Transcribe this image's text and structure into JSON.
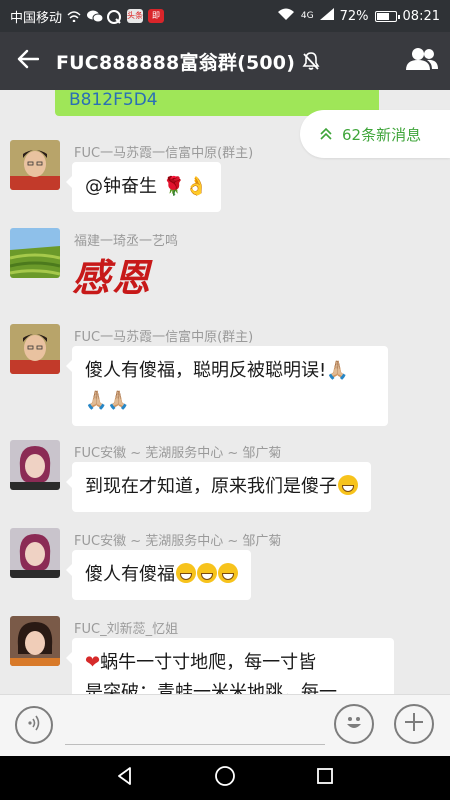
{
  "status": {
    "carrier": "中国移动",
    "network": "4G",
    "battery": "72%",
    "battery_level": 0.72,
    "time": "08:21",
    "app_badges": [
      "头条",
      "即"
    ]
  },
  "header": {
    "title": "FUC888888富翁群(500)",
    "icons": [
      "back-arrow-icon",
      "mute-icon",
      "group-members-icon"
    ]
  },
  "chat": {
    "previous_bubble_text": "B812F5D4",
    "new_messages_label": "62条新消息",
    "messages": [
      {
        "sender": "FUC一马苏霞一信富中原(群主)",
        "text": "@钟奋生 🌹👌"
      },
      {
        "sender": "福建一琦丞一艺鸣",
        "sticker_text": "感恩"
      },
      {
        "sender": "FUC一马苏霞一信富中原(群主)",
        "line1": "傻人有傻福，聪明反被聪明误!🙏🏼",
        "line2": "🙏🏼🙏🏼"
      },
      {
        "sender": "FUC安徽 ~ 芜湖服务中心 ~ 邹广菊",
        "text": "到现在才知道，原来我们是傻子"
      },
      {
        "sender": "FUC安徽 ~ 芜湖服务中心 ~ 邹广菊",
        "text": "傻人有傻福"
      },
      {
        "sender": "FUC_刘新蕊_忆姐",
        "line1": "蜗牛一寸寸地爬，每一寸皆",
        "line2": "是突破；青蛙一米米地跳，每一"
      }
    ]
  },
  "input": {
    "placeholder": ""
  },
  "colors": {
    "title_bar": "#393a3f",
    "status_bar": "#2f3236",
    "chat_bg": "#ebebeb",
    "accent_green": "#3fa53a",
    "own_bubble": "#9fe658"
  }
}
